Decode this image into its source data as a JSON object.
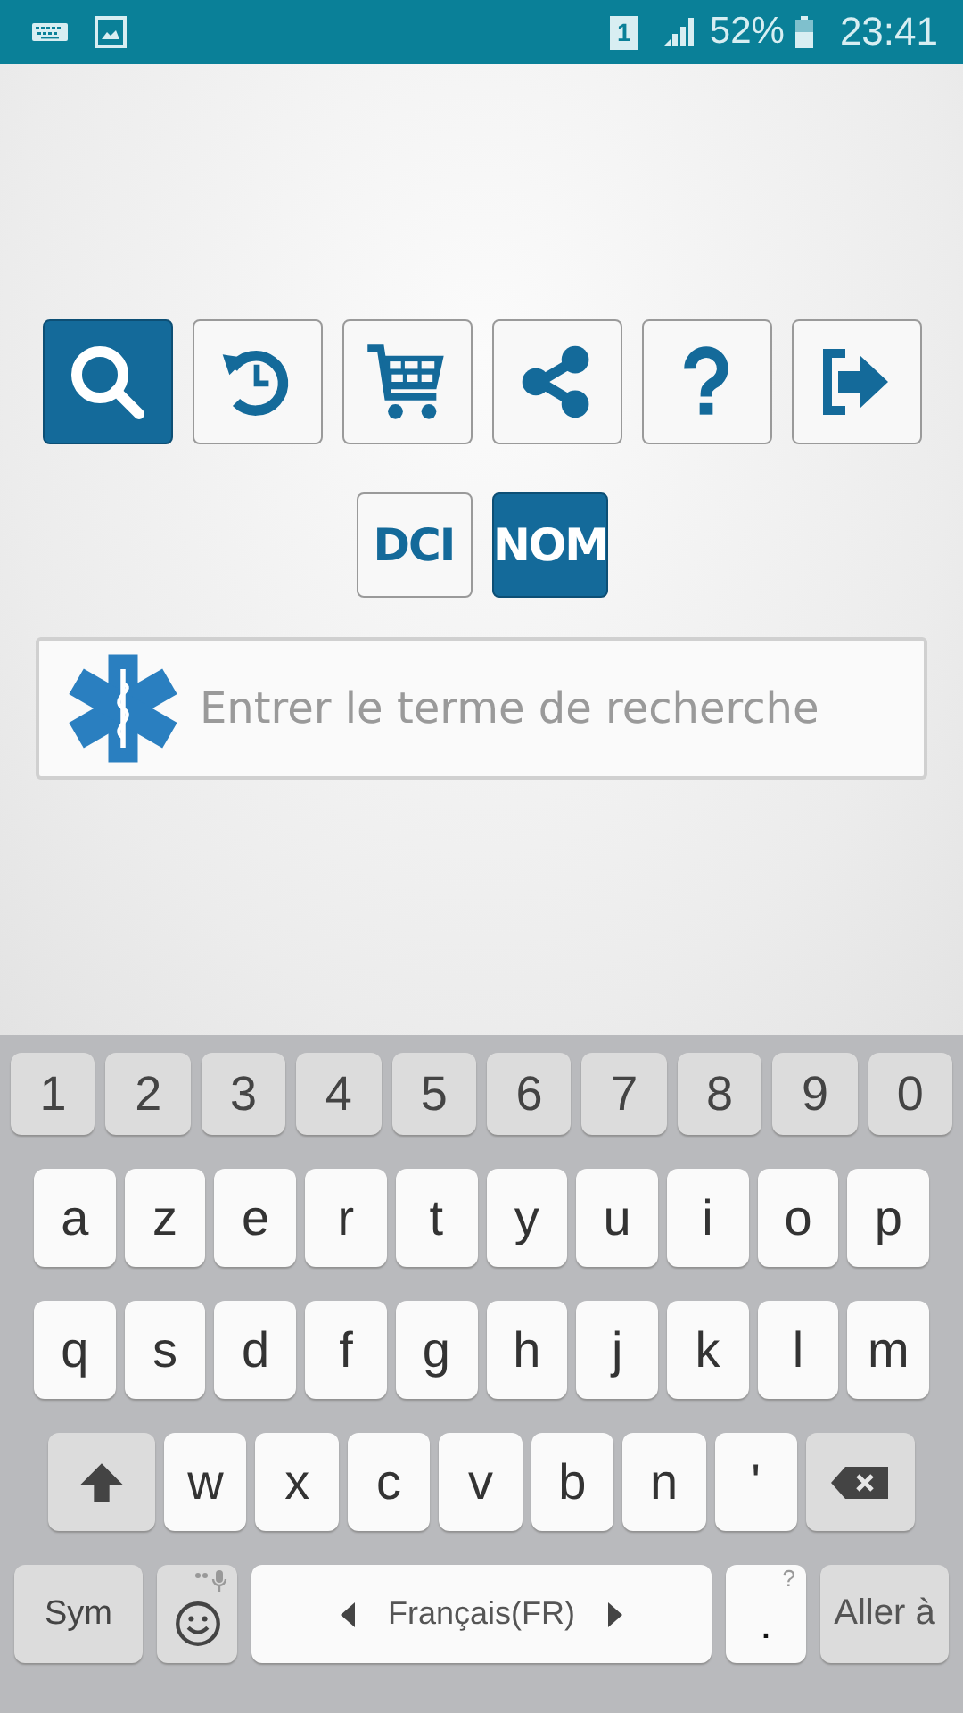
{
  "status_bar": {
    "sim": "1",
    "battery": "52%",
    "time": "23:41"
  },
  "toolbar": [
    {
      "kind": "search",
      "selected": true
    },
    {
      "kind": "history",
      "selected": false
    },
    {
      "kind": "cart",
      "selected": false
    },
    {
      "kind": "share",
      "selected": false
    },
    {
      "kind": "help",
      "selected": false
    },
    {
      "kind": "exit",
      "selected": false
    }
  ],
  "mode_toggle": [
    {
      "label": "DCI",
      "selected": false
    },
    {
      "label": "NOM",
      "selected": true
    }
  ],
  "search": {
    "placeholder": "Entrer le terme de recherche"
  },
  "keyboard": {
    "rows": [
      [
        {
          "kind": "num",
          "label": "1"
        },
        {
          "kind": "num",
          "label": "2"
        },
        {
          "kind": "num",
          "label": "3"
        },
        {
          "kind": "num",
          "label": "4"
        },
        {
          "kind": "num",
          "label": "5"
        },
        {
          "kind": "num",
          "label": "6"
        },
        {
          "kind": "num",
          "label": "7"
        },
        {
          "kind": "num",
          "label": "8"
        },
        {
          "kind": "num",
          "label": "9"
        },
        {
          "kind": "num",
          "label": "0"
        }
      ],
      [
        {
          "kind": "char",
          "label": "a"
        },
        {
          "kind": "char",
          "label": "z"
        },
        {
          "kind": "char",
          "label": "e"
        },
        {
          "kind": "char",
          "label": "r"
        },
        {
          "kind": "char",
          "label": "t"
        },
        {
          "kind": "char",
          "label": "y"
        },
        {
          "kind": "char",
          "label": "u"
        },
        {
          "kind": "char",
          "label": "i"
        },
        {
          "kind": "char",
          "label": "o"
        },
        {
          "kind": "char",
          "label": "p"
        }
      ],
      [
        {
          "kind": "char",
          "label": "q"
        },
        {
          "kind": "char",
          "label": "s"
        },
        {
          "kind": "char",
          "label": "d"
        },
        {
          "kind": "char",
          "label": "f"
        },
        {
          "kind": "char",
          "label": "g"
        },
        {
          "kind": "char",
          "label": "h"
        },
        {
          "kind": "char",
          "label": "j"
        },
        {
          "kind": "char",
          "label": "k"
        },
        {
          "kind": "char",
          "label": "l"
        },
        {
          "kind": "char",
          "label": "m"
        }
      ],
      [
        {
          "kind": "shift"
        },
        {
          "kind": "char",
          "label": "w"
        },
        {
          "kind": "char",
          "label": "x"
        },
        {
          "kind": "char",
          "label": "c"
        },
        {
          "kind": "char",
          "label": "v"
        },
        {
          "kind": "char",
          "label": "b"
        },
        {
          "kind": "char",
          "label": "n"
        },
        {
          "kind": "char",
          "label": "'"
        },
        {
          "kind": "backspace"
        }
      ]
    ],
    "bottom_row": [
      {
        "kind": "sym",
        "label": "Sym"
      },
      {
        "kind": "emoji"
      },
      {
        "kind": "space",
        "label": "Français(FR)"
      },
      {
        "kind": "period",
        "label": ".",
        "hint": "?"
      },
      {
        "kind": "go",
        "label": "Aller à"
      }
    ]
  }
}
